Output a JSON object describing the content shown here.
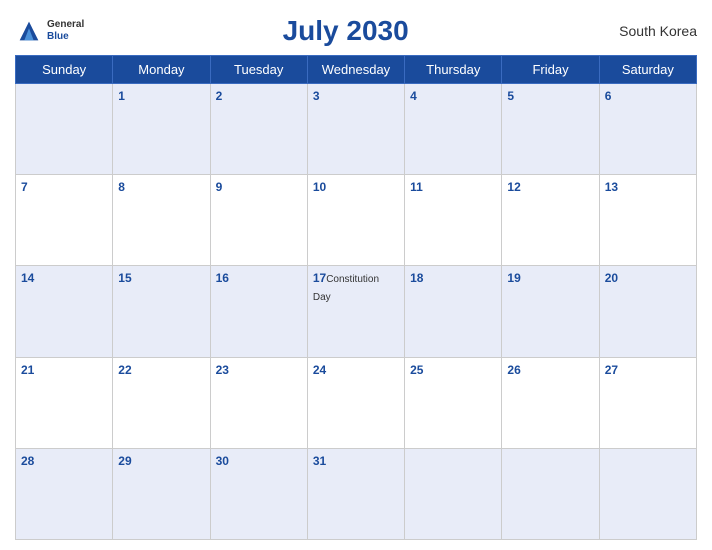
{
  "header": {
    "title": "July 2030",
    "country": "South Korea",
    "logo_general": "General",
    "logo_blue": "Blue"
  },
  "days_of_week": [
    "Sunday",
    "Monday",
    "Tuesday",
    "Wednesday",
    "Thursday",
    "Friday",
    "Saturday"
  ],
  "weeks": [
    [
      {
        "num": "",
        "event": ""
      },
      {
        "num": "1",
        "event": ""
      },
      {
        "num": "2",
        "event": ""
      },
      {
        "num": "3",
        "event": ""
      },
      {
        "num": "4",
        "event": ""
      },
      {
        "num": "5",
        "event": ""
      },
      {
        "num": "6",
        "event": ""
      }
    ],
    [
      {
        "num": "7",
        "event": ""
      },
      {
        "num": "8",
        "event": ""
      },
      {
        "num": "9",
        "event": ""
      },
      {
        "num": "10",
        "event": ""
      },
      {
        "num": "11",
        "event": ""
      },
      {
        "num": "12",
        "event": ""
      },
      {
        "num": "13",
        "event": ""
      }
    ],
    [
      {
        "num": "14",
        "event": ""
      },
      {
        "num": "15",
        "event": ""
      },
      {
        "num": "16",
        "event": ""
      },
      {
        "num": "17",
        "event": "Constitution Day"
      },
      {
        "num": "18",
        "event": ""
      },
      {
        "num": "19",
        "event": ""
      },
      {
        "num": "20",
        "event": ""
      }
    ],
    [
      {
        "num": "21",
        "event": ""
      },
      {
        "num": "22",
        "event": ""
      },
      {
        "num": "23",
        "event": ""
      },
      {
        "num": "24",
        "event": ""
      },
      {
        "num": "25",
        "event": ""
      },
      {
        "num": "26",
        "event": ""
      },
      {
        "num": "27",
        "event": ""
      }
    ],
    [
      {
        "num": "28",
        "event": ""
      },
      {
        "num": "29",
        "event": ""
      },
      {
        "num": "30",
        "event": ""
      },
      {
        "num": "31",
        "event": ""
      },
      {
        "num": "",
        "event": ""
      },
      {
        "num": "",
        "event": ""
      },
      {
        "num": "",
        "event": ""
      }
    ]
  ]
}
